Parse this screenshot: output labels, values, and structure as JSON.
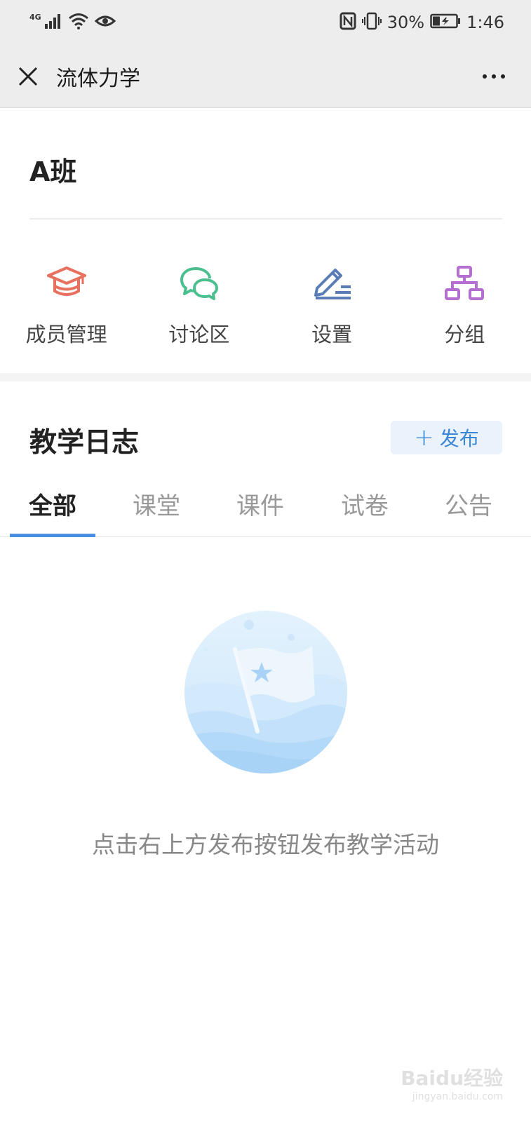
{
  "status_bar": {
    "network": "4G",
    "battery": "30%",
    "time": "1:46"
  },
  "nav": {
    "title": "流体力学"
  },
  "class_header": {
    "title": "A班"
  },
  "quick_actions": [
    {
      "label": "成员管理",
      "icon": "graduation-cap-icon",
      "color": "#e8705f"
    },
    {
      "label": "讨论区",
      "icon": "chat-bubbles-icon",
      "color": "#4cbf8f"
    },
    {
      "label": "设置",
      "icon": "pencil-list-icon",
      "color": "#5a7db5"
    },
    {
      "label": "分组",
      "icon": "org-chart-icon",
      "color": "#b56fd0"
    }
  ],
  "teaching_log": {
    "title": "教学日志",
    "publish_label": "发布",
    "tabs": [
      "全部",
      "课堂",
      "课件",
      "试卷",
      "公告"
    ],
    "active_tab": "全部"
  },
  "empty_state": {
    "message": "点击右上方发布按钮发布教学活动"
  },
  "watermark": {
    "brand": "Baidu经验",
    "url": "jingyan.baidu.com"
  },
  "colors": {
    "accent": "#4a90e2",
    "topbar_bg": "#ededed"
  }
}
